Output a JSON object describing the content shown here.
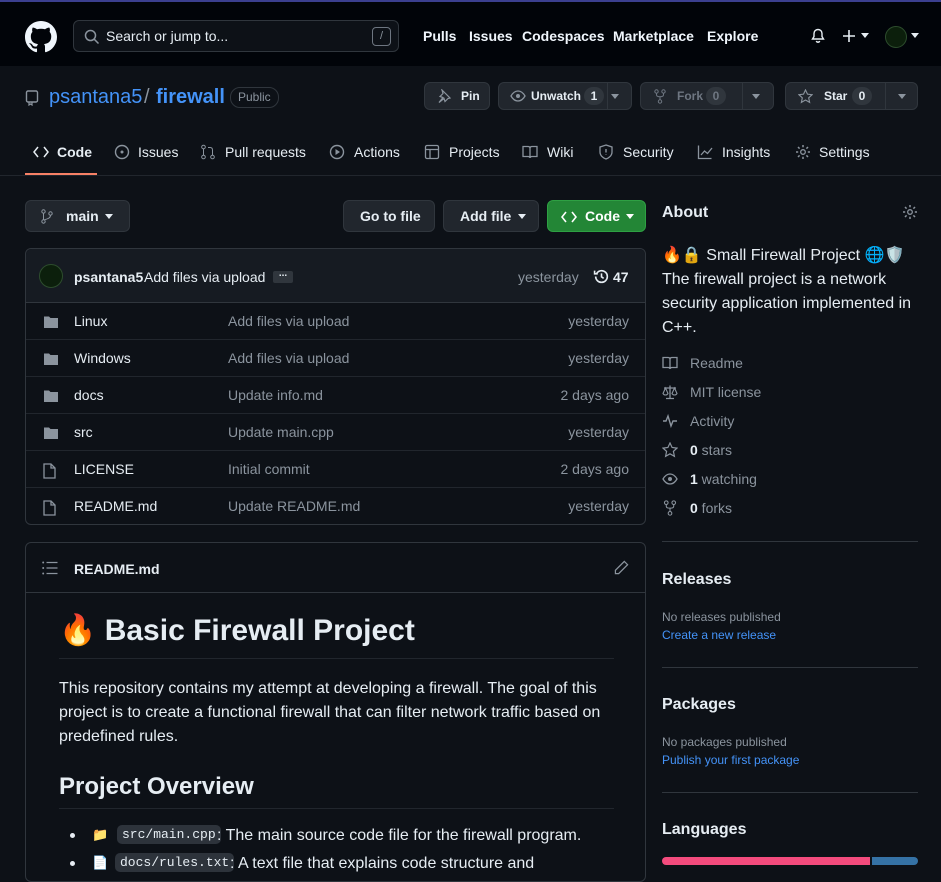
{
  "header": {
    "search_placeholder": "Search or jump to...",
    "search_shortcut": "/",
    "nav": [
      "Pulls",
      "Issues",
      "Codespaces",
      "Marketplace",
      "Explore"
    ]
  },
  "repo": {
    "owner": "psantana5",
    "separator": "/",
    "name": "firewall",
    "visibility": "Public",
    "pin_label": "Pin",
    "watch_label": "Unwatch",
    "watch_count": "1",
    "fork_label": "Fork",
    "fork_count": "0",
    "star_label": "Star",
    "star_count": "0"
  },
  "tabs": [
    "Code",
    "Issues",
    "Pull requests",
    "Actions",
    "Projects",
    "Wiki",
    "Security",
    "Insights",
    "Settings"
  ],
  "toolbar": {
    "branch": "main",
    "goto_file": "Go to file",
    "add_file": "Add file",
    "code": "Code"
  },
  "commit": {
    "author": "psantana5",
    "message": "Add files via upload",
    "ellipsis": "...",
    "time": "yesterday",
    "count": "47"
  },
  "files": [
    {
      "name": "Linux",
      "type": "folder",
      "message": "Add files via upload",
      "time": "yesterday"
    },
    {
      "name": "Windows",
      "type": "folder",
      "message": "Add files via upload",
      "time": "yesterday"
    },
    {
      "name": "docs",
      "type": "folder",
      "message": "Update info.md",
      "time": "2 days ago"
    },
    {
      "name": "src",
      "type": "folder",
      "message": "Update main.cpp",
      "time": "yesterday"
    },
    {
      "name": "LICENSE",
      "type": "file",
      "message": "Initial commit",
      "time": "2 days ago"
    },
    {
      "name": "README.md",
      "type": "file",
      "message": "Update README.md",
      "time": "yesterday"
    }
  ],
  "readme": {
    "filename": "README.md",
    "title": "Basic Firewall Project",
    "title_emoji": "🔥",
    "intro": "This repository contains my attempt at developing a firewall. The goal of this project is to create a functional firewall that can filter network traffic based on predefined rules.",
    "overview_heading": "Project Overview",
    "bullets": [
      {
        "emoji": "📁",
        "code": "src/main.cpp",
        "text": ": The main source code file for the firewall program."
      },
      {
        "emoji": "📄",
        "code": "docs/rules.txt",
        "text": ": A text file that explains code structure and"
      }
    ]
  },
  "about": {
    "heading": "About",
    "description_prefix": "🔥🔒",
    "description": "Small Firewall Project",
    "description_suffix": "🌐🛡️",
    "description_rest": "The firewall project is a network security application implemented in C++.",
    "links": [
      {
        "icon": "book-icon",
        "label": "Readme"
      },
      {
        "icon": "law-icon",
        "label": "MIT license"
      },
      {
        "icon": "pulse-icon",
        "label": "Activity"
      },
      {
        "icon": "star-icon",
        "label": "0 stars"
      },
      {
        "icon": "eye-icon",
        "label": "1 watching"
      },
      {
        "icon": "fork-icon",
        "label": "0 forks"
      }
    ]
  },
  "releases": {
    "heading": "Releases",
    "empty": "No releases published",
    "link": "Create a new release"
  },
  "packages": {
    "heading": "Packages",
    "empty": "No packages published",
    "link": "Publish your first package"
  },
  "languages": {
    "heading": "Languages",
    "bar": [
      {
        "color": "#f34b7d",
        "fraction": 0.82
      },
      {
        "color": "#3572A5",
        "fraction": 0.18
      }
    ]
  }
}
